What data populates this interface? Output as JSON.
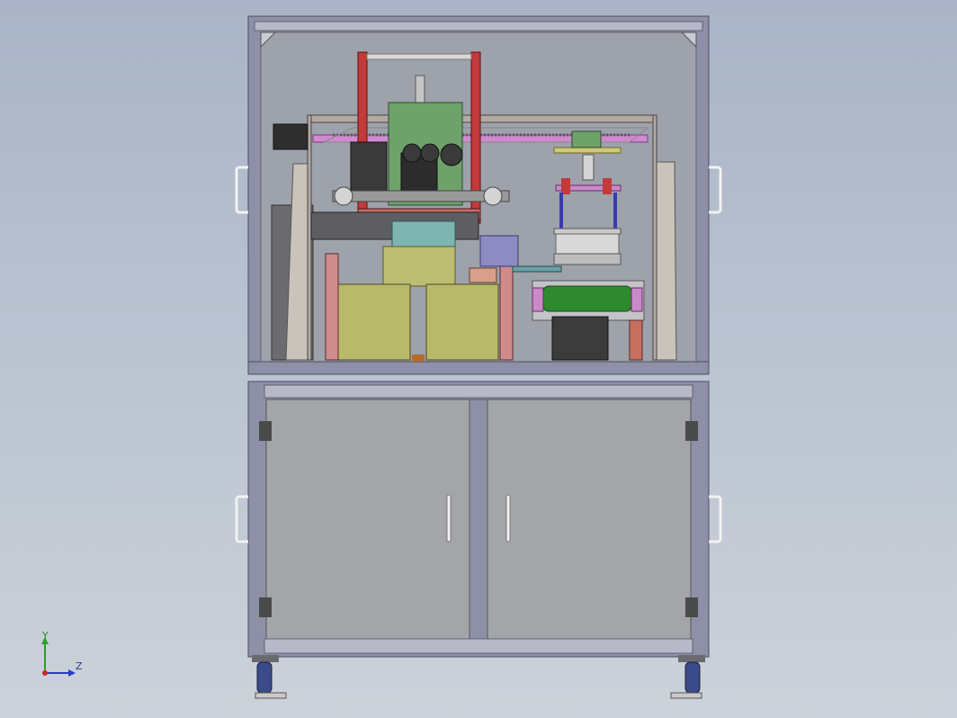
{
  "view": {
    "background_top": "#a9b4c6",
    "background_bottom": "#ccd2d9"
  },
  "colors": {
    "frame_profile": "#8d90a6",
    "frame_profile_dark": "#5f6277",
    "enclosure_glass": "#9ba0a8",
    "cabinet_door": "#a3a5a8",
    "mechanism_red": "#b63a3a",
    "mechanism_green": "#6fa26a",
    "feeder_olive": "#b9b96a",
    "roller_green": "#2f8a2f",
    "rail_magenta": "#c87ac8",
    "caster_blue": "#3a4a8a"
  },
  "triad": {
    "y_label": "Y",
    "z_label": "Z",
    "x_icon": "axis-origin-icon"
  }
}
